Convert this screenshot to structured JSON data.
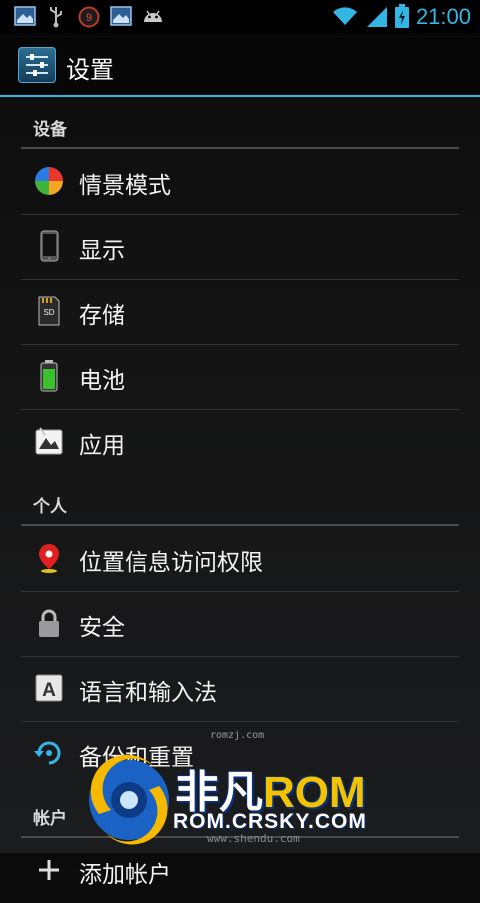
{
  "status_bar": {
    "time": "21:00",
    "notification_badge": "9",
    "accent_color": "#33b5e5"
  },
  "action_bar": {
    "title": "设置",
    "icon": "settings-icon"
  },
  "sections": [
    {
      "header": "设备",
      "items": [
        {
          "label": "情景模式",
          "icon": "profiles-icon"
        },
        {
          "label": "显示",
          "icon": "display-icon"
        },
        {
          "label": "存储",
          "icon": "storage-icon"
        },
        {
          "label": "电池",
          "icon": "battery-icon"
        },
        {
          "label": "应用",
          "icon": "apps-icon"
        }
      ]
    },
    {
      "header": "个人",
      "items": [
        {
          "label": "位置信息访问权限",
          "icon": "location-icon"
        },
        {
          "label": "安全",
          "icon": "lock-icon"
        },
        {
          "label": "语言和输入法",
          "icon": "language-icon"
        },
        {
          "label": "备份和重置",
          "icon": "backup-icon"
        }
      ]
    },
    {
      "header": "帐户",
      "items": [
        {
          "label": "添加帐户",
          "icon": "add-icon"
        }
      ]
    }
  ],
  "watermark": {
    "top": "romzj.com",
    "bottom": "www.shendu.com"
  },
  "logo": {
    "name_cn": "非凡",
    "name_rom": "ROM",
    "url": "ROM.CRSKY.COM"
  }
}
